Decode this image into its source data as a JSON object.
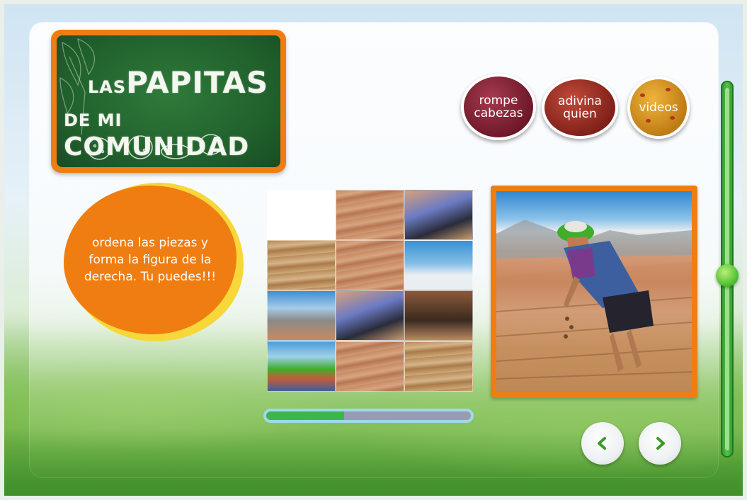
{
  "logo": {
    "line1_small": "LAS",
    "line1_big": "PAPITAS",
    "line2_small": "DE MI",
    "line2_big": "COMUNIDAD"
  },
  "menu": {
    "puzzle_label_1": "rompe",
    "puzzle_label_2": "cabezas",
    "guess_label_1": "adivina",
    "guess_label_2": "quien",
    "videos_label": "videos"
  },
  "instructions": {
    "text": "ordena las piezas y forma la figura de la derecha. Tu puedes!!!"
  },
  "progress": {
    "fraction": 0.38
  },
  "colors": {
    "accent_orange": "#f07d12",
    "accent_yellow": "#f7d73a",
    "board_green": "#1f5e2b",
    "nav_arrow_green": "#3a9a2a",
    "progress_fill": "#3db54a"
  },
  "icons": {
    "prev": "chevron-left-icon",
    "next": "chevron-right-icon"
  }
}
